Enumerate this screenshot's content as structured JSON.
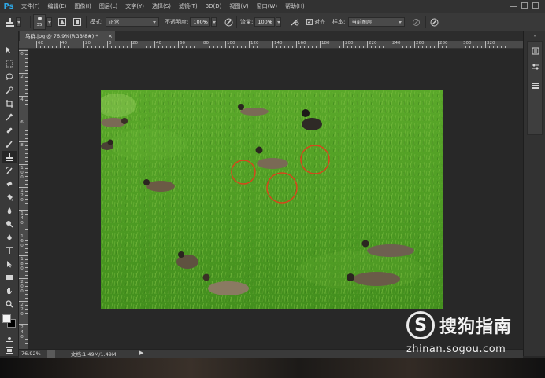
{
  "app": {
    "logo": "Ps",
    "menu": [
      "文件(F)",
      "编辑(E)",
      "图像(I)",
      "图层(L)",
      "文字(Y)",
      "选择(S)",
      "滤镜(T)",
      "3D(D)",
      "视图(V)",
      "窗口(W)",
      "帮助(H)"
    ]
  },
  "options": {
    "brush_size": "35",
    "mode_label": "模式:",
    "mode_value": "正常",
    "opacity_label": "不透明度:",
    "opacity_value": "100%",
    "flow_label": "流量:",
    "flow_value": "100%",
    "aligned_label": "对齐",
    "aligned_checked": "✓",
    "sample_label": "样本:",
    "sample_value": "当前图层"
  },
  "document": {
    "tab_title": "鸟群.jpg @ 76.9%(RGB/8#) *",
    "close": "×"
  },
  "ruler": {
    "top_labels": [
      "60",
      "40",
      "20",
      "0",
      "20",
      "40",
      "60",
      "80",
      "100",
      "120",
      "140",
      "160",
      "180",
      "200",
      "220",
      "240",
      "260",
      "280",
      "300",
      "320"
    ],
    "left_labels": [
      "0",
      "2",
      "4",
      "6",
      "8",
      "1 0 0",
      "1 2 0",
      "1 4 0",
      "1 6 0",
      "1 8 0",
      "2 0 0",
      "2 2 0",
      "2 4 0"
    ]
  },
  "status": {
    "zoom": "76.92%",
    "doc_info": "文档:1.49M/1.49M",
    "arrow": "▶"
  },
  "watermark": {
    "logo_letter": "S",
    "brand": "搜狗指南",
    "url": "zhinan.sogou.com"
  },
  "colors": {
    "grass": "#4f9d24",
    "circle": "#d8451c",
    "panel": "#393939",
    "canvas_bg": "#282828"
  }
}
